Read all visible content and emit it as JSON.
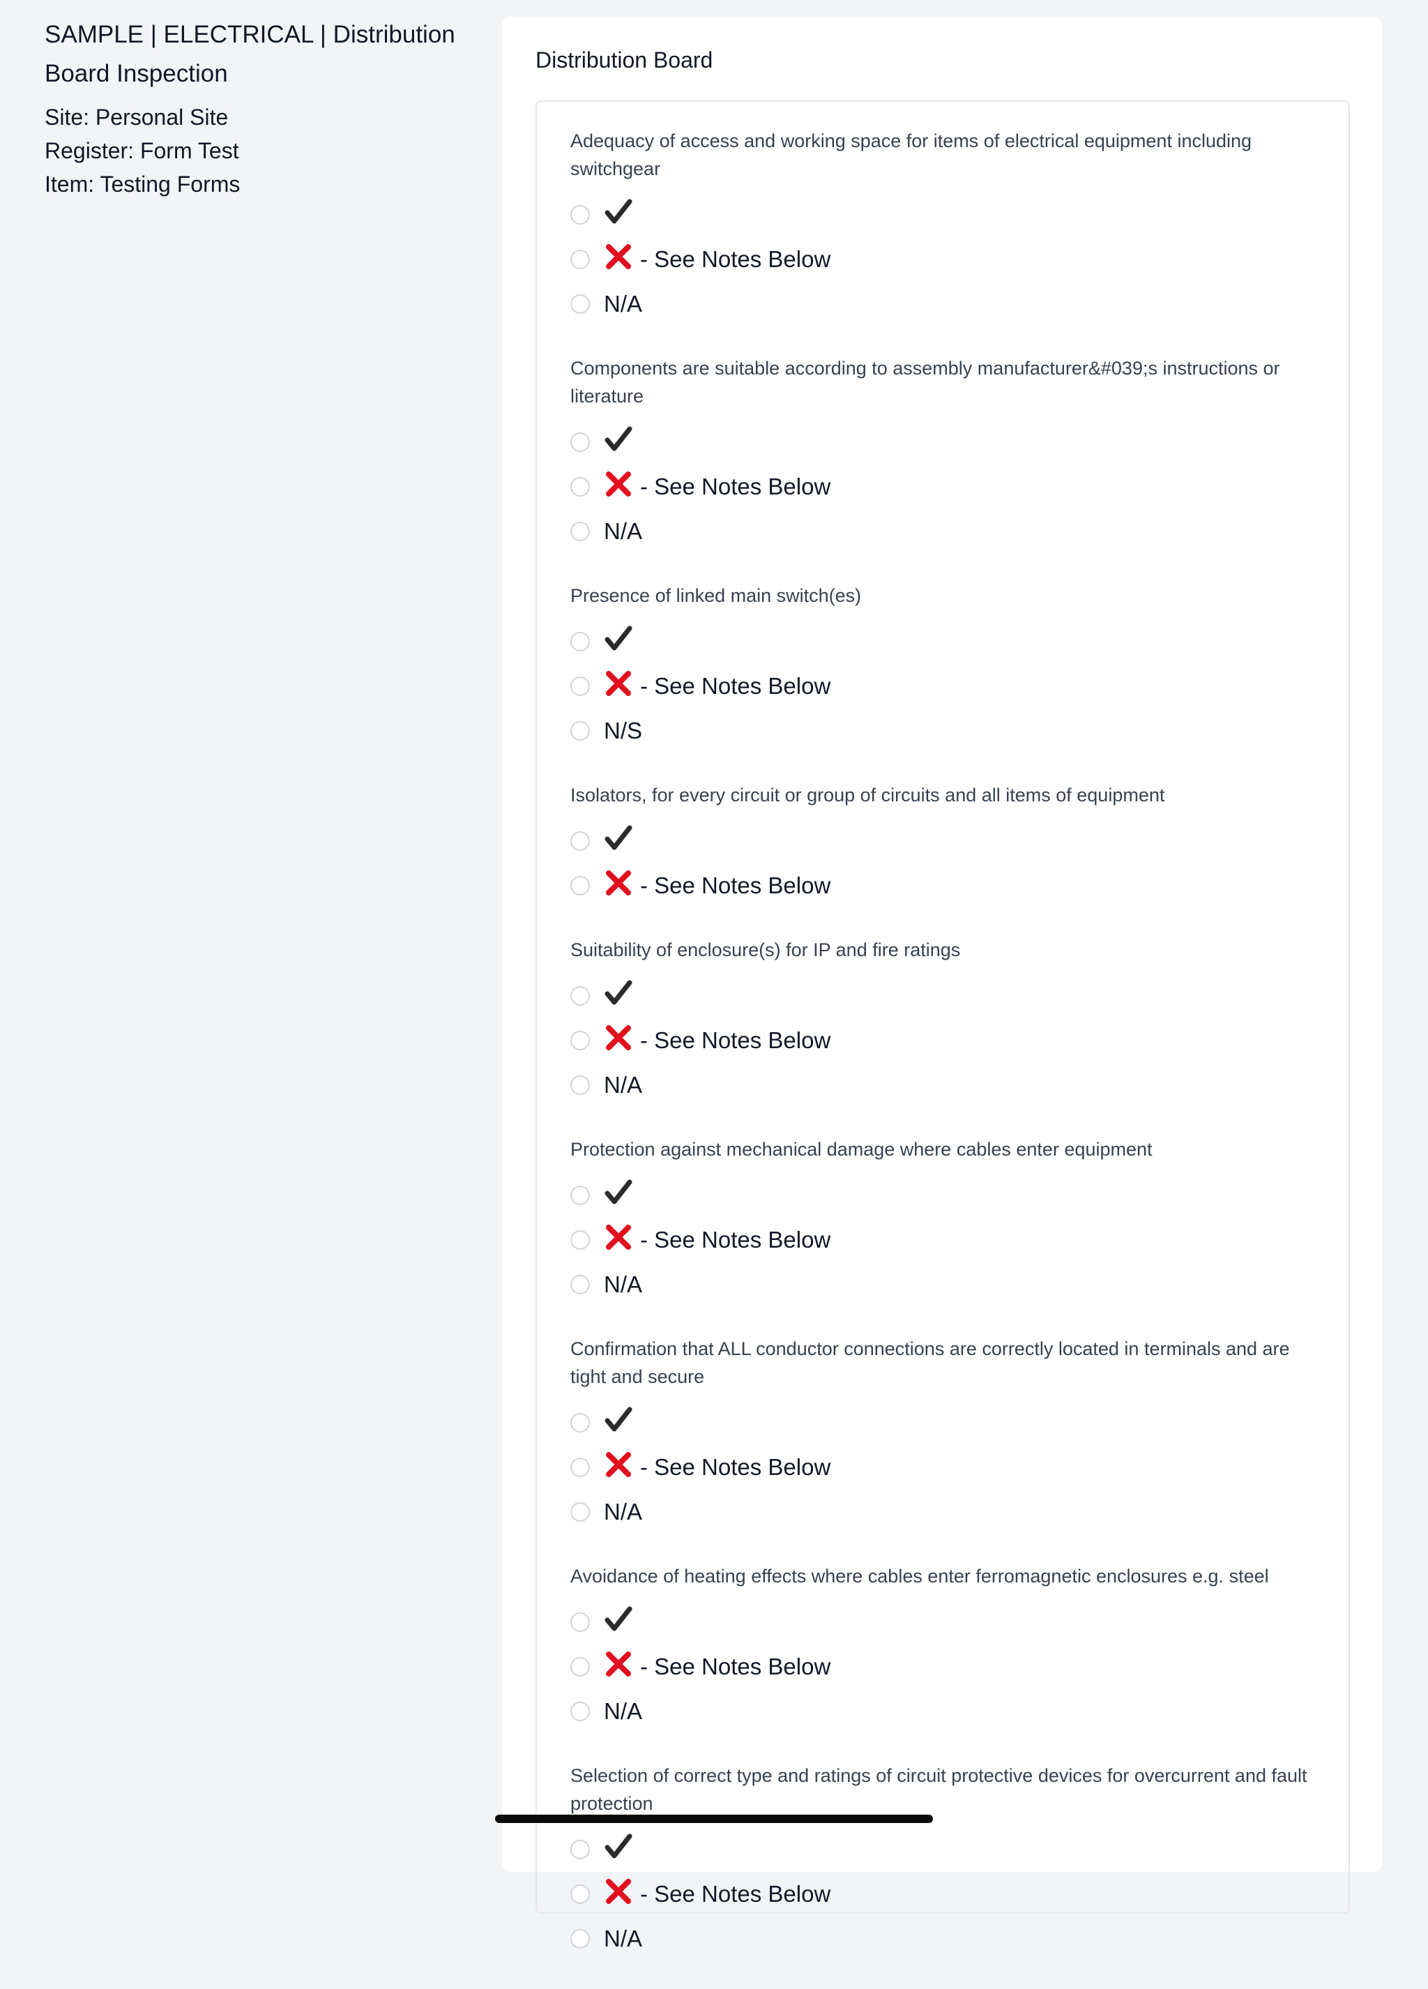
{
  "header": {
    "title": "SAMPLE | ELECTRICAL | Distribution Board Inspection",
    "site": "Site: Personal Site",
    "register": "Register: Form Test",
    "item": "Item: Testing Forms"
  },
  "section": {
    "title": "Distribution Board"
  },
  "option_labels": {
    "fail_suffix": "- See Notes Below"
  },
  "questions": [
    {
      "label": "Adequacy of access and working space for items of electrical equipment including switchgear",
      "options": [
        "check",
        "cross",
        "N/A"
      ]
    },
    {
      "label": "Components are suitable according to assembly manufacturer&#039;s instructions or literature",
      "options": [
        "check",
        "cross",
        "N/A"
      ]
    },
    {
      "label": "Presence of linked main switch(es)",
      "options": [
        "check",
        "cross",
        "N/S"
      ]
    },
    {
      "label": "Isolators, for every circuit or group of circuits and all items of equipment",
      "options": [
        "check",
        "cross"
      ]
    },
    {
      "label": "Suitability of enclosure(s) for IP and fire ratings",
      "options": [
        "check",
        "cross",
        "N/A"
      ]
    },
    {
      "label": "Protection against mechanical damage where cables enter equipment",
      "options": [
        "check",
        "cross",
        "N/A"
      ]
    },
    {
      "label": "Confirmation that ALL conductor connections are correctly located in terminals and are tight and secure",
      "options": [
        "check",
        "cross",
        "N/A"
      ]
    },
    {
      "label": "Avoidance of heating effects where cables enter ferromagnetic enclosures e.g. steel",
      "options": [
        "check",
        "cross",
        "N/A"
      ]
    },
    {
      "label": "Selection of correct type and ratings of circuit protective devices for overcurrent and fault protection",
      "options": [
        "check",
        "cross",
        "N/A"
      ]
    }
  ],
  "icons": {
    "check": "check-icon",
    "cross": "cross-icon"
  },
  "colors": {
    "cross": "#e0101e",
    "check": "#2b2b2b"
  }
}
